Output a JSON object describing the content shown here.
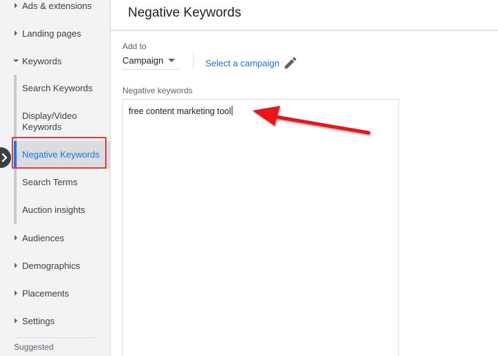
{
  "sidebar": {
    "items": [
      {
        "label": "Ads & extensions"
      },
      {
        "label": "Landing pages"
      },
      {
        "label": "Keywords"
      }
    ],
    "keywords_subitems": [
      {
        "label": "Search Keywords"
      },
      {
        "label": "Display/Video Keywords"
      },
      {
        "label": "Negative Keywords",
        "active": true
      },
      {
        "label": "Search Terms"
      },
      {
        "label": "Auction insights"
      }
    ],
    "more_items": [
      {
        "label": "Audiences"
      },
      {
        "label": "Demographics"
      },
      {
        "label": "Placements"
      },
      {
        "label": "Settings"
      }
    ],
    "suggested_label": "Suggested"
  },
  "header": {
    "title": "Negative Keywords"
  },
  "form": {
    "add_to_label": "Add to",
    "add_to_value": "Campaign",
    "select_campaign_label": "Select a campaign",
    "negative_keywords_label": "Negative keywords",
    "negative_keywords_value": "free content marketing tool"
  },
  "colors": {
    "accent": "#1a73e8",
    "highlight": "#e53935",
    "sidebar_bg": "#f1f3f4"
  },
  "icons": {
    "caret": "caret-right-icon",
    "expanded_caret": "caret-down-icon",
    "collapse": "chevron-right-icon",
    "dropdown": "arrow-drop-down-icon",
    "edit": "pencil-icon",
    "annotation": "red-arrow-annotation"
  }
}
